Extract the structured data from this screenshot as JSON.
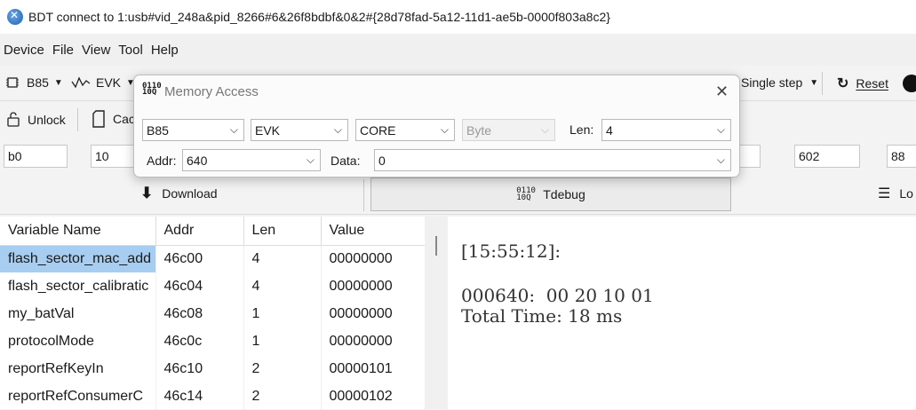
{
  "window": {
    "title": "BDT connect to 1:usb#vid_248a&pid_8266#6&26f8bdbf&0&2#{28d78fad-5a12-11d1-ae5b-0000f803a8c2}"
  },
  "menu": [
    "Device",
    "File",
    "View",
    "Tool",
    "Help"
  ],
  "toolbar1": {
    "chip": "B85",
    "board": "EVK",
    "step": "Single step",
    "reset": "Reset"
  },
  "toolbar2": {
    "unlock": "Unlock",
    "cache": "Cac"
  },
  "toolbar3": {
    "field1": "b0",
    "field2": "10",
    "field3": "602",
    "field4": "88"
  },
  "toolbar4": {
    "download": "Download",
    "tdebug": "Tdebug",
    "log": "Lo"
  },
  "dialog": {
    "title": "Memory Access",
    "chip": "B85",
    "board": "EVK",
    "region": "CORE",
    "unit": "Byte",
    "len_label": "Len:",
    "len_value": "4",
    "addr_label": "Addr:",
    "addr_value": "640",
    "data_label": "Data:",
    "data_value": "0"
  },
  "table": {
    "headers": [
      "Variable Name",
      "Addr",
      "Len",
      "Value"
    ],
    "rows": [
      [
        "flash_sector_mac_add",
        "46c00",
        "4",
        "00000000"
      ],
      [
        "flash_sector_calibratic",
        "46c04",
        "4",
        "00000000"
      ],
      [
        "my_batVal",
        "46c08",
        "1",
        "00000000"
      ],
      [
        "protocolMode",
        "46c0c",
        "1",
        "00000000"
      ],
      [
        "reportRefKeyIn",
        "46c10",
        "2",
        "00000101"
      ],
      [
        "reportRefConsumerC",
        "46c14",
        "2",
        "00000102"
      ]
    ]
  },
  "output": {
    "line1": "[15:55:12]:",
    "line2": "000640:  00 20 10 01",
    "line3": "Total Time: 18 ms"
  }
}
